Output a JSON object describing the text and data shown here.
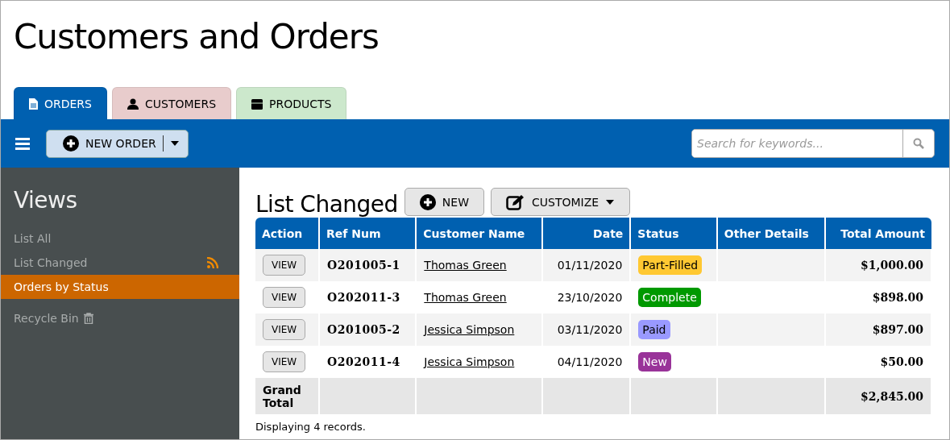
{
  "page_title": "Customers and Orders",
  "tabs": [
    {
      "label": "ORDERS",
      "kind": "document",
      "selected": true,
      "color": "#0060b0"
    },
    {
      "label": "CUSTOMERS",
      "kind": "person",
      "selected": false,
      "color": "#e8cccc"
    },
    {
      "label": "PRODUCTS",
      "kind": "box",
      "selected": false,
      "color": "#cce8cc"
    }
  ],
  "toolbar": {
    "new_order_button": "NEW ORDER",
    "search": {
      "placeholder": "Search for keywords..."
    }
  },
  "sidebar": {
    "title": "Views",
    "items": [
      {
        "label": "List All",
        "kind": "plain",
        "selected": false
      },
      {
        "label": "List Changed",
        "kind": "feed",
        "selected": false
      },
      {
        "label": "Orders by Status",
        "kind": "plain",
        "selected": true
      },
      {
        "label": "Recycle Bin",
        "kind": "trash",
        "selected": false
      }
    ]
  },
  "content": {
    "heading": "List Changed",
    "new_button": "NEW",
    "customize_button": "CUSTOMIZE"
  },
  "table": {
    "columns": [
      "Action",
      "Ref Num",
      "Customer Name",
      "Date",
      "Status",
      "Other Details",
      "Total Amount"
    ],
    "rows": [
      {
        "action": "VIEW",
        "ref": "O201005-1",
        "customer": "Thomas Green",
        "date": "01/11/2020",
        "status": {
          "label": "Part-Filled",
          "color": "#ffc832"
        },
        "total": "$1,000.00"
      },
      {
        "action": "VIEW",
        "ref": "O202011-3",
        "customer": "Thomas Green",
        "date": "23/10/2020",
        "status": {
          "label": "Complete",
          "color": "#009900"
        },
        "total": "$898.00"
      },
      {
        "action": "VIEW",
        "ref": "O201005-2",
        "customer": "Jessica Simpson",
        "date": "03/11/2020",
        "status": {
          "label": "Paid",
          "color": "#9999ff"
        },
        "total": "$897.00"
      },
      {
        "action": "VIEW",
        "ref": "O202011-4",
        "customer": "Jessica Simpson",
        "date": "04/11/2020",
        "status": {
          "label": "New",
          "color": "#993399"
        },
        "total": "$50.00"
      }
    ],
    "grand_total": {
      "label": "Grand Total",
      "total": "$2,845.00"
    }
  },
  "footer": "Displaying 4 records."
}
